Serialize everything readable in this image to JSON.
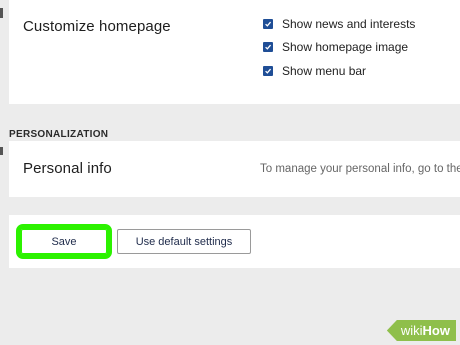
{
  "homepage": {
    "title": "Customize homepage",
    "options": [
      {
        "label": "Show news and interests",
        "checked": true
      },
      {
        "label": "Show homepage image",
        "checked": true
      },
      {
        "label": "Show menu bar",
        "checked": true
      }
    ]
  },
  "personalization": {
    "heading": "PERSONALIZATION",
    "personal_info": {
      "title": "Personal info",
      "description": "To manage your personal info, go to the"
    }
  },
  "actions": {
    "save_label": "Save",
    "default_label": "Use default settings"
  },
  "watermark": {
    "wiki": "wiki",
    "how": "How"
  },
  "colors": {
    "checkbox": "#1f4e96",
    "highlight": "#2cf200",
    "watermark": "#8fbf4b"
  }
}
